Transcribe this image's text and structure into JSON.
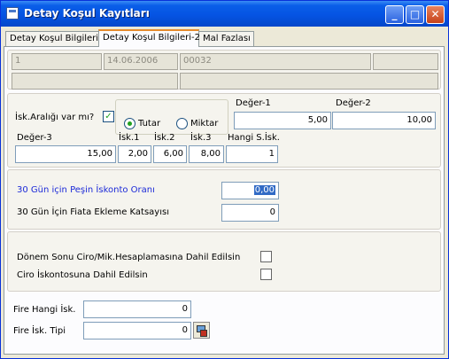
{
  "window": {
    "title": "Detay Koşul Kayıtları",
    "minimize": "_",
    "maximize": "□",
    "close": "✕"
  },
  "tabs": [
    "Detay Koşul Bilgileri",
    "Detay Koşul Bilgileri-2",
    "Mal Fazlası"
  ],
  "header": {
    "f1": "1",
    "f2": "14.06.2006",
    "f3": "00032",
    "f4": "",
    "f5": "",
    "f6": ""
  },
  "discount": {
    "question": "İsk.Aralığı var mı?",
    "checked": "✓",
    "radio_tutar": "Tutar",
    "radio_miktar": "Miktar",
    "deger1_label": "Değer-1",
    "deger1": "5,00",
    "deger2_label": "Değer-2",
    "deger2": "10,00",
    "deger3_label": "Değer-3",
    "deger3": "15,00",
    "isk1_label": "İsk.1",
    "isk1": "2,00",
    "isk2_label": "İsk.2",
    "isk2": "6,00",
    "isk3_label": "İsk.3",
    "isk3": "8,00",
    "hangi_label": "Hangi S.İsk.",
    "hangi": "1"
  },
  "pesin": {
    "label1": "30 Gün için Peşin İskonto Oranı",
    "value1": "0,00",
    "label2": "30 Gün İçin Fiata Ekleme Katsayısı",
    "value2": "0"
  },
  "donem": {
    "label1": "Dönem Sonu Ciro/Mik.Hesaplamasına Dahil Edilsin",
    "label2": "Ciro İskontosuna Dahil Edilsin"
  },
  "fire": {
    "label1": "Fire Hangi İsk.",
    "value1": "0",
    "label2": "Fire İsk. Tipi",
    "value2": "0"
  }
}
